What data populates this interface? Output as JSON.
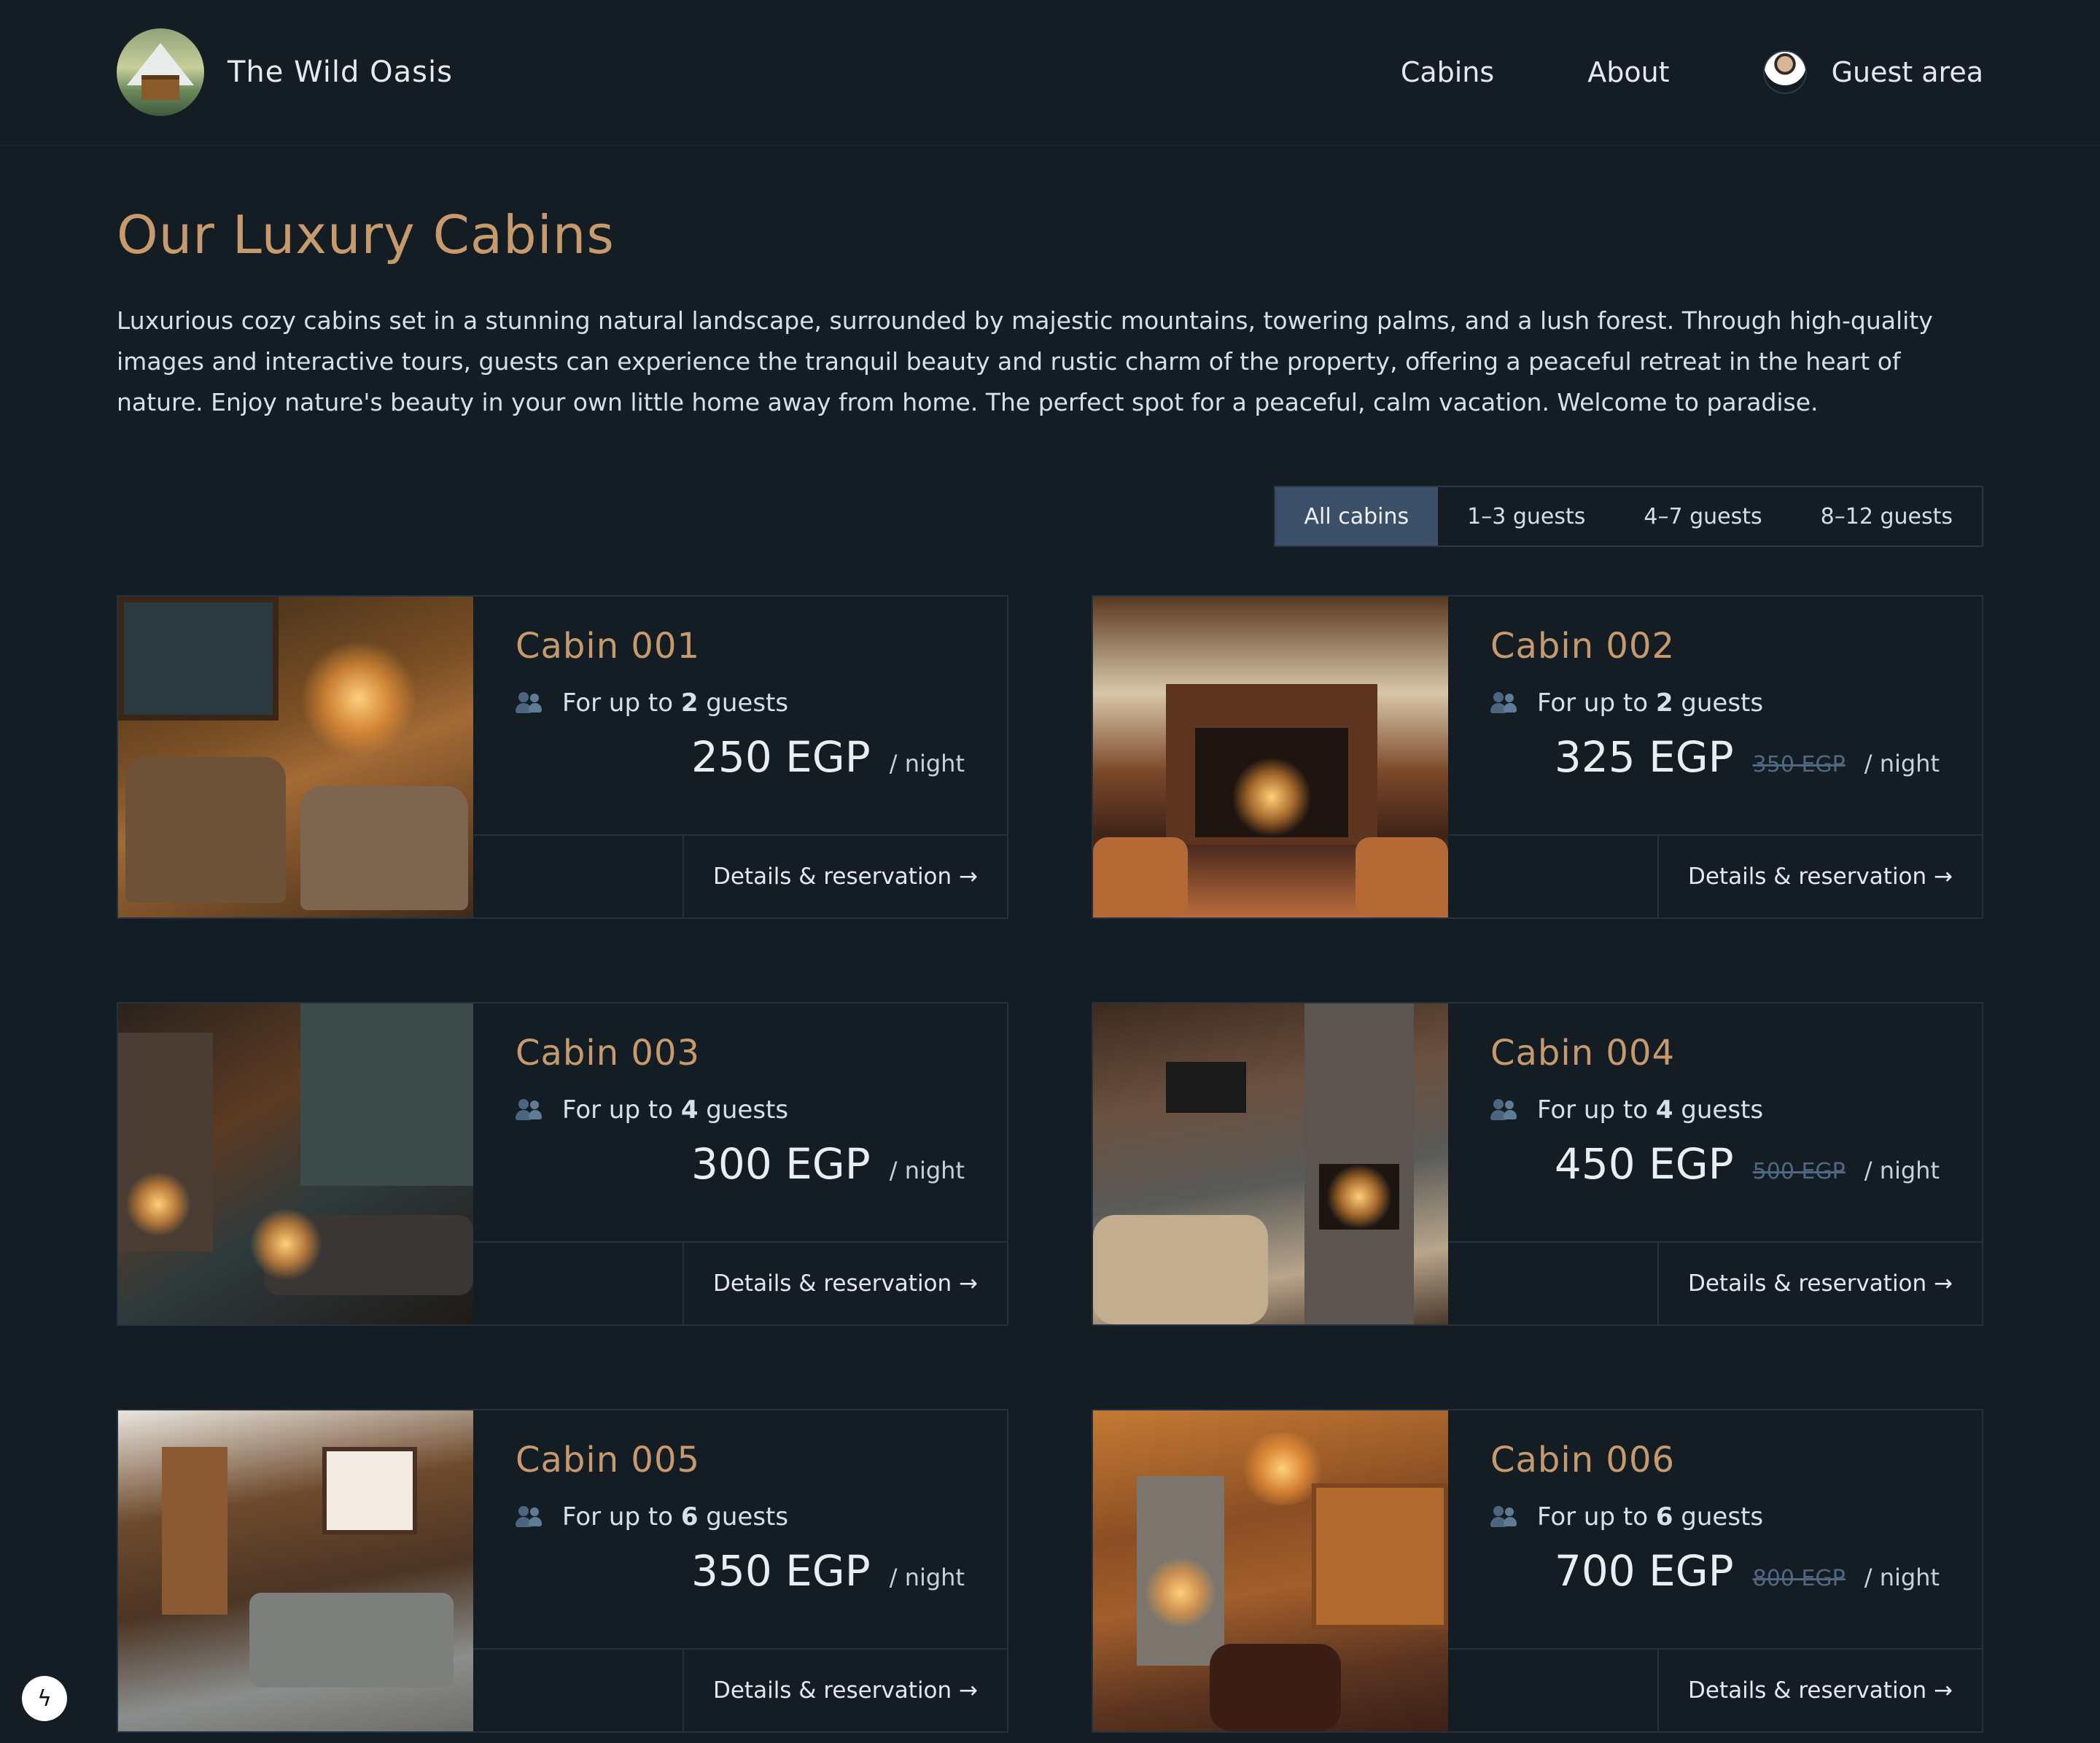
{
  "header": {
    "brand": "The Wild Oasis",
    "nav": [
      "Cabins",
      "About",
      "Guest area"
    ]
  },
  "main": {
    "title": "Our Luxury Cabins",
    "intro": "Luxurious cozy cabins set in a stunning natural landscape, surrounded by majestic mountains, towering palms, and a lush forest. Through high-quality images and interactive tours, guests can experience the tranquil beauty and rustic charm of the property, offering a peaceful retreat in the heart of nature. Enjoy nature's beauty in your own little home away from home. The perfect spot for a peaceful, calm vacation. Welcome to paradise.",
    "filters": [
      "All cabins",
      "1–3 guests",
      "4–7 guests",
      "8–12 guests"
    ],
    "active_filter": "All cabins"
  },
  "cabins": [
    {
      "name": "Cabin 001",
      "guests_prefix": "For up to ",
      "guests": "2",
      "guests_suffix": " guests",
      "price": "250 EGP",
      "old_price": "",
      "per": "/ night",
      "cta": "Details & reservation →"
    },
    {
      "name": "Cabin 002",
      "guests_prefix": "For up to ",
      "guests": "2",
      "guests_suffix": " guests",
      "price": "325 EGP",
      "old_price": "350 EGP",
      "per": "/ night",
      "cta": "Details & reservation →"
    },
    {
      "name": "Cabin 003",
      "guests_prefix": "For up to ",
      "guests": "4",
      "guests_suffix": " guests",
      "price": "300 EGP",
      "old_price": "",
      "per": "/ night",
      "cta": "Details & reservation →"
    },
    {
      "name": "Cabin 004",
      "guests_prefix": "For up to ",
      "guests": "4",
      "guests_suffix": " guests",
      "price": "450 EGP",
      "old_price": "500 EGP",
      "per": "/ night",
      "cta": "Details & reservation →"
    },
    {
      "name": "Cabin 005",
      "guests_prefix": "For up to ",
      "guests": "6",
      "guests_suffix": " guests",
      "price": "350 EGP",
      "old_price": "",
      "per": "/ night",
      "cta": "Details & reservation →"
    },
    {
      "name": "Cabin 006",
      "guests_prefix": "For up to ",
      "guests": "6",
      "guests_suffix": " guests",
      "price": "700 EGP",
      "old_price": "800 EGP",
      "per": "/ night",
      "cta": "Details & reservation →"
    }
  ],
  "colors": {
    "background": "#141c24",
    "accent": "#c69a6c",
    "active_filter": "#3b5068"
  },
  "icons": {
    "logo": "cabin-mountain-logo",
    "guests": "users-icon",
    "dev_badge": "lightning-icon"
  }
}
